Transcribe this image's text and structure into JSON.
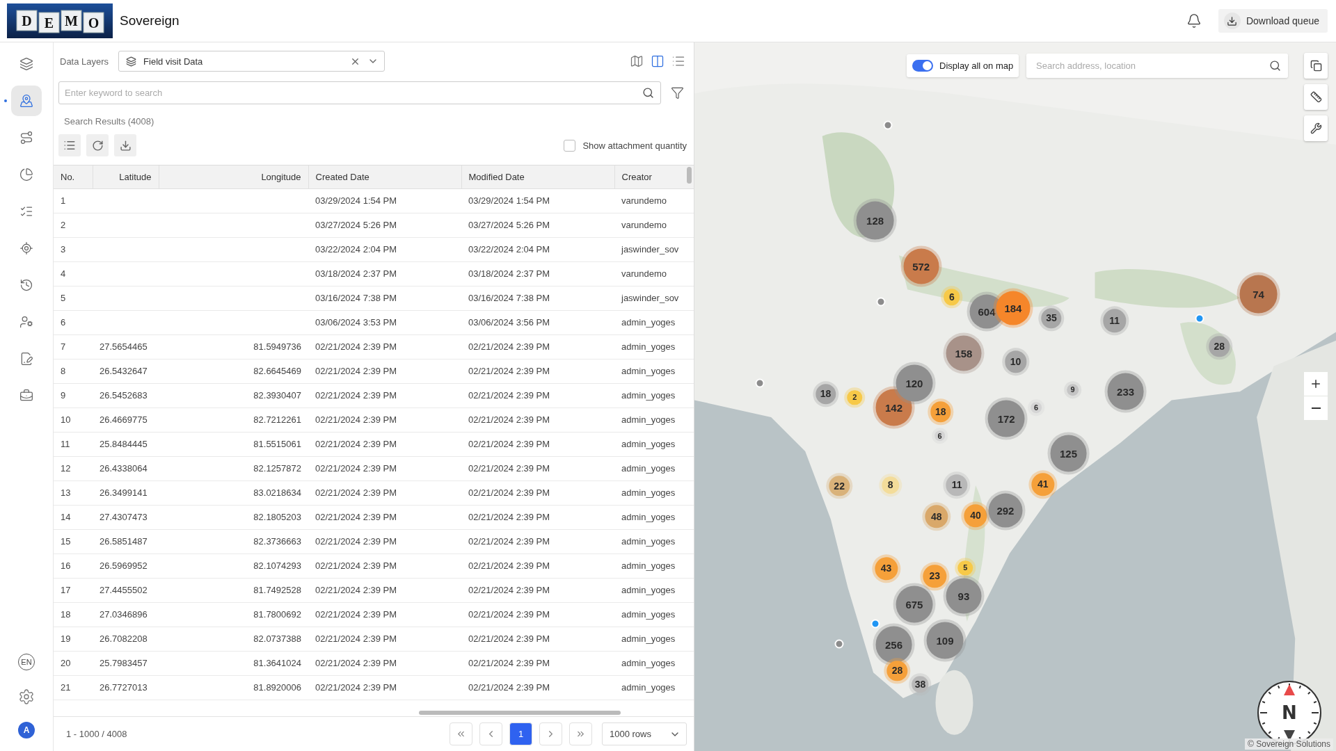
{
  "header": {
    "logo_letters": [
      "D",
      "E",
      "M",
      "O"
    ],
    "app_name": "Sovereign",
    "download_button": "Download queue"
  },
  "sidebar": {
    "items": [
      {
        "selected": false
      },
      {
        "selected": true
      },
      {
        "selected": false
      },
      {
        "selected": false
      },
      {
        "selected": false
      },
      {
        "selected": false
      },
      {
        "selected": false
      },
      {
        "selected": false
      },
      {
        "selected": false
      },
      {
        "selected": false
      }
    ],
    "language": "EN",
    "avatar": "A"
  },
  "panel": {
    "data_layers_label": "Data Layers",
    "layer_value": "Field visit Data",
    "view_modes": [
      {
        "selected": false
      },
      {
        "selected": true
      },
      {
        "selected": false
      }
    ],
    "search": {
      "placeholder": "Enter keyword to search"
    },
    "results_label": "Search Results (4008)",
    "show_attachment": {
      "label": "Show attachment quantity",
      "checked": false
    }
  },
  "table": {
    "columns": [
      "No.",
      "Latitude",
      "Longitude",
      "Created Date",
      "Modified Date",
      "Creator"
    ],
    "rows": [
      {
        "no": "1",
        "created": "03/29/2024 1:54 PM",
        "modified": "03/29/2024 1:54 PM",
        "creator": "varundemo"
      },
      {
        "no": "2",
        "created": "03/27/2024 5:26 PM",
        "modified": "03/27/2024 5:26 PM",
        "creator": "varundemo"
      },
      {
        "no": "3",
        "created": "03/22/2024 2:04 PM",
        "modified": "03/22/2024 2:04 PM",
        "creator": "jaswinder_sov"
      },
      {
        "no": "4",
        "created": "03/18/2024 2:37 PM",
        "modified": "03/18/2024 2:37 PM",
        "creator": "varundemo"
      },
      {
        "no": "5",
        "created": "03/16/2024 7:38 PM",
        "modified": "03/16/2024 7:38 PM",
        "creator": "jaswinder_sov"
      },
      {
        "no": "6",
        "created": "03/06/2024 3:53 PM",
        "modified": "03/06/2024 3:56 PM",
        "creator": "admin_yoges"
      },
      {
        "no": "7",
        "latitude": "27.5654465",
        "longitude": "81.5949736",
        "created": "02/21/2024 2:39 PM",
        "modified": "02/21/2024 2:39 PM",
        "creator": "admin_yoges"
      },
      {
        "no": "8",
        "latitude": "26.5432647",
        "longitude": "82.6645469",
        "created": "02/21/2024 2:39 PM",
        "modified": "02/21/2024 2:39 PM",
        "creator": "admin_yoges"
      },
      {
        "no": "9",
        "latitude": "26.5452683",
        "longitude": "82.3930407",
        "created": "02/21/2024 2:39 PM",
        "modified": "02/21/2024 2:39 PM",
        "creator": "admin_yoges"
      },
      {
        "no": "10",
        "latitude": "26.4669775",
        "longitude": "82.7212261",
        "created": "02/21/2024 2:39 PM",
        "modified": "02/21/2024 2:39 PM",
        "creator": "admin_yoges"
      },
      {
        "no": "11",
        "latitude": "25.8484445",
        "longitude": "81.5515061",
        "created": "02/21/2024 2:39 PM",
        "modified": "02/21/2024 2:39 PM",
        "creator": "admin_yoges"
      },
      {
        "no": "12",
        "latitude": "26.4338064",
        "longitude": "82.1257872",
        "created": "02/21/2024 2:39 PM",
        "modified": "02/21/2024 2:39 PM",
        "creator": "admin_yoges"
      },
      {
        "no": "13",
        "latitude": "26.3499141",
        "longitude": "83.0218634",
        "created": "02/21/2024 2:39 PM",
        "modified": "02/21/2024 2:39 PM",
        "creator": "admin_yoges"
      },
      {
        "no": "14",
        "latitude": "27.4307473",
        "longitude": "82.1805203",
        "created": "02/21/2024 2:39 PM",
        "modified": "02/21/2024 2:39 PM",
        "creator": "admin_yoges"
      },
      {
        "no": "15",
        "latitude": "26.5851487",
        "longitude": "82.3736663",
        "created": "02/21/2024 2:39 PM",
        "modified": "02/21/2024 2:39 PM",
        "creator": "admin_yoges"
      },
      {
        "no": "16",
        "latitude": "26.5969952",
        "longitude": "82.1074293",
        "created": "02/21/2024 2:39 PM",
        "modified": "02/21/2024 2:39 PM",
        "creator": "admin_yoges"
      },
      {
        "no": "17",
        "latitude": "27.4455502",
        "longitude": "81.7492528",
        "created": "02/21/2024 2:39 PM",
        "modified": "02/21/2024 2:39 PM",
        "creator": "admin_yoges"
      },
      {
        "no": "18",
        "latitude": "27.0346896",
        "longitude": "81.7800692",
        "created": "02/21/2024 2:39 PM",
        "modified": "02/21/2024 2:39 PM",
        "creator": "admin_yoges"
      },
      {
        "no": "19",
        "latitude": "26.7082208",
        "longitude": "82.0737388",
        "created": "02/21/2024 2:39 PM",
        "modified": "02/21/2024 2:39 PM",
        "creator": "admin_yoges"
      },
      {
        "no": "20",
        "latitude": "25.7983457",
        "longitude": "81.3641024",
        "created": "02/21/2024 2:39 PM",
        "modified": "02/21/2024 2:39 PM",
        "creator": "admin_yoges"
      },
      {
        "no": "21",
        "latitude": "26.7727013",
        "longitude": "81.8920006",
        "created": "02/21/2024 2:39 PM",
        "modified": "02/21/2024 2:39 PM",
        "creator": "admin_yoges"
      }
    ]
  },
  "pagination": {
    "range": "1 - 1000 / 4008",
    "pages": [
      {
        "label": "1",
        "selected": true
      }
    ],
    "rows_select": "1000 rows"
  },
  "map": {
    "display_all": {
      "label": "Display all on map",
      "on": true
    },
    "search": {
      "placeholder": "Search address, location"
    },
    "compass_label": "N",
    "attribution": "© Sovereign Solutions",
    "markers": [
      {
        "kind": "dot",
        "color": "#8c8c8c"
      },
      {
        "kind": "cluster",
        "label": "128",
        "color": "#8f8f8f"
      },
      {
        "kind": "cluster",
        "label": "572",
        "color": "#c97b4b"
      },
      {
        "kind": "dot",
        "color": "#8c8c8c"
      },
      {
        "kind": "cluster",
        "label": "6",
        "color": "#f7c948"
      },
      {
        "kind": "cluster",
        "label": "604",
        "color": "#8f8f8f"
      },
      {
        "kind": "cluster",
        "label": "184",
        "color": "#f5862a"
      },
      {
        "kind": "cluster",
        "label": "35",
        "color": "#a6a6a6"
      },
      {
        "kind": "cluster",
        "label": "11",
        "color": "#a6a6a6"
      },
      {
        "kind": "dot",
        "color": "#2196f3"
      },
      {
        "kind": "cluster",
        "label": "74",
        "color": "#b8764f"
      },
      {
        "kind": "cluster",
        "label": "158",
        "color": "#a89289"
      },
      {
        "kind": "cluster",
        "label": "10",
        "color": "#a6a6a6"
      },
      {
        "kind": "cluster",
        "label": "28",
        "color": "#a6a6a6"
      },
      {
        "kind": "dot",
        "color": "#8c8c8c"
      },
      {
        "kind": "cluster",
        "label": "18",
        "color": "#a6a6a6"
      },
      {
        "kind": "cluster",
        "label": "2",
        "color": "#f7c948"
      },
      {
        "kind": "cluster",
        "label": "142",
        "color": "#c97b4b"
      },
      {
        "kind": "cluster",
        "label": "120",
        "color": "#8f8f8f"
      },
      {
        "kind": "cluster",
        "label": "18",
        "color": "#f5a03a"
      },
      {
        "kind": "cluster",
        "label": "172",
        "color": "#8f8f8f"
      },
      {
        "kind": "cluster",
        "label": "6",
        "color": "#d4d4d4"
      },
      {
        "kind": "cluster",
        "label": "9",
        "color": "#c4c4c4"
      },
      {
        "kind": "cluster",
        "label": "233",
        "color": "#8f8f8f"
      },
      {
        "kind": "cluster",
        "label": "6",
        "color": "#d4d4d4"
      },
      {
        "kind": "cluster",
        "label": "125",
        "color": "#8f8f8f"
      },
      {
        "kind": "cluster",
        "label": "22",
        "color": "#d9b27a"
      },
      {
        "kind": "cluster",
        "label": "8",
        "color": "#f3dc9a"
      },
      {
        "kind": "cluster",
        "label": "11",
        "color": "#b8b8b8"
      },
      {
        "kind": "cluster",
        "label": "41",
        "color": "#f5a03a"
      },
      {
        "kind": "cluster",
        "label": "48",
        "color": "#d9a86a"
      },
      {
        "kind": "cluster",
        "label": "40",
        "color": "#f5a03a"
      },
      {
        "kind": "cluster",
        "label": "292",
        "color": "#8f8f8f"
      },
      {
        "kind": "cluster",
        "label": "43",
        "color": "#f5a03a"
      },
      {
        "kind": "cluster",
        "label": "23",
        "color": "#f5a03a"
      },
      {
        "kind": "cluster",
        "label": "5",
        "color": "#f7c948"
      },
      {
        "kind": "cluster",
        "label": "675",
        "color": "#8f8f8f"
      },
      {
        "kind": "cluster",
        "label": "93",
        "color": "#8f8f8f"
      },
      {
        "kind": "dot",
        "color": "#2196f3"
      },
      {
        "kind": "dot",
        "color": "#8c8c8c"
      },
      {
        "kind": "cluster",
        "label": "256",
        "color": "#8f8f8f"
      },
      {
        "kind": "cluster",
        "label": "109",
        "color": "#8f8f8f"
      },
      {
        "kind": "cluster",
        "label": "28",
        "color": "#f5a03a"
      },
      {
        "kind": "cluster",
        "label": "38",
        "color": "#b8b8b8"
      }
    ]
  }
}
